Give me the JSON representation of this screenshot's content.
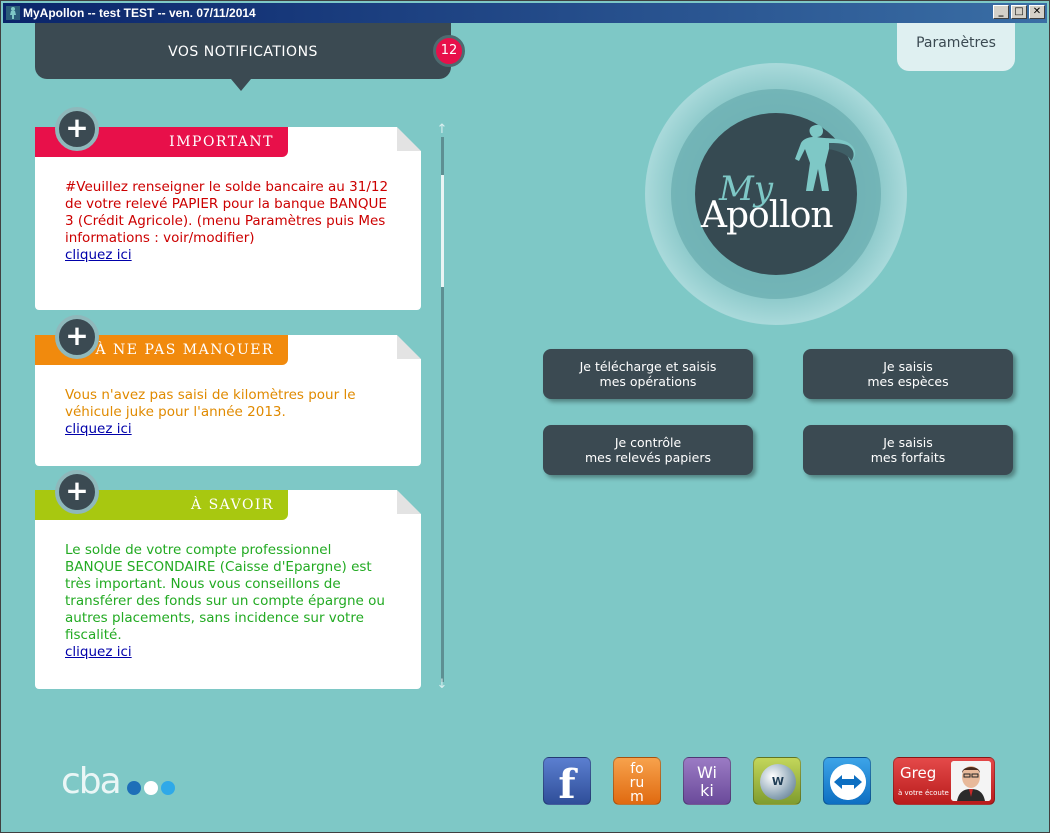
{
  "window": {
    "title": "MyApollon  --  test TEST  --  ven. 07/11/2014",
    "minimize": "_",
    "maximize": "□",
    "close": "✕"
  },
  "notifications": {
    "header": "VOS NOTIFICATIONS",
    "count": "12"
  },
  "settings": {
    "label": "Paramètres"
  },
  "cards": [
    {
      "tag": "IMPORTANT",
      "color": "#e8104a",
      "text": "#Veuillez renseigner le solde bancaire au 31/12 de votre relevé PAPIER pour la banque BANQUE 3 (Crédit Agricole). (menu Paramètres puis Mes informations : voir/modifier)",
      "link": "cliquez ici"
    },
    {
      "tag": "À NE PAS MANQUER",
      "color": "#f18a0d",
      "text": "Vous n'avez pas saisi de kilomètres pour le véhicule juke pour l'année 2013.",
      "link": "cliquez ici"
    },
    {
      "tag": "À SAVOIR",
      "color": "#a8c810",
      "text": "Le solde de votre compte professionnel BANQUE SECONDAIRE (Caisse d'Epargne) est très important. Nous vous conseillons de transférer des fonds sur un compte épargne ou autres placements, sans incidence sur votre fiscalité.",
      "link": "cliquez ici"
    }
  ],
  "logo": {
    "my": "My",
    "apollon": "Apollon"
  },
  "actions": {
    "telecharge": "Je télécharge et saisis\nmes opérations",
    "especes": "Je saisis\nmes espèces",
    "releves": "Je contrôle\nmes relevés papiers",
    "forfaits": "Je saisis\nmes forfaits"
  },
  "footer": {
    "cba": "cba",
    "cba_dot_colors": [
      "#1e6fb8",
      "#ffffff",
      "#2fa9e8"
    ],
    "facebook": "f",
    "forum_lines": [
      "fo",
      "ru",
      "m"
    ],
    "wiki_lines": [
      "Wi",
      "ki"
    ],
    "www": "W",
    "greg_name": "Greg",
    "greg_sub": "à votre écoute"
  },
  "icons": {
    "plus": "+",
    "scroll_up": "↑",
    "scroll_down": "↓"
  }
}
